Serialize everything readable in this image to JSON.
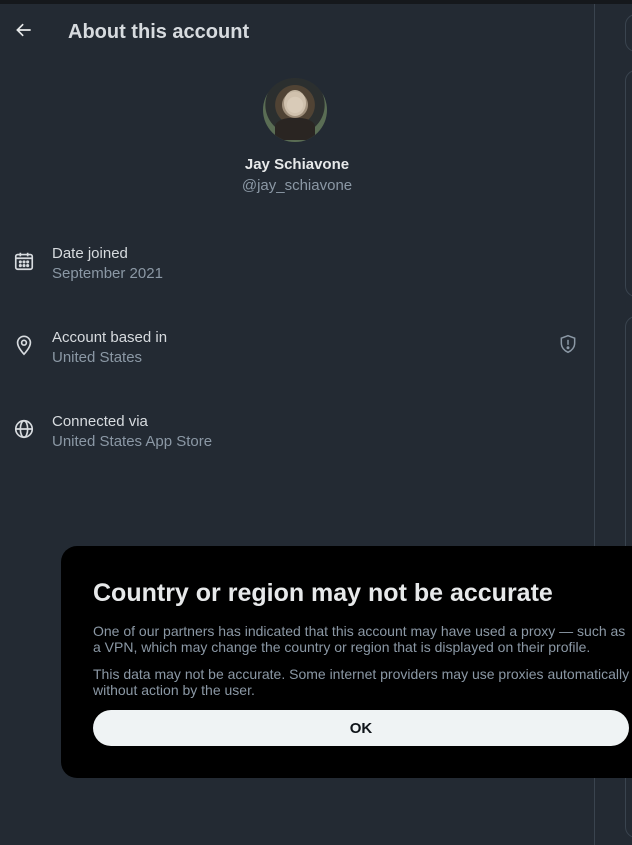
{
  "header": {
    "title": "About this account"
  },
  "profile": {
    "name": "Jay Schiavone",
    "handle": "@jay_schiavone"
  },
  "details": [
    {
      "label": "Date joined",
      "value": "September 2021",
      "icon": "calendar-icon"
    },
    {
      "label": "Account based in",
      "value": "United States",
      "icon": "location-pin-icon",
      "extra_icon": "shield-alert-icon"
    },
    {
      "label": "Connected via",
      "value": "United States App Store",
      "icon": "globe-icon"
    }
  ],
  "dialog": {
    "title": "Country or region may not be accurate",
    "paragraph1": "One of our partners has indicated that this account may have used a proxy — such as a VPN, which may change the country or region that is displayed on their profile.",
    "paragraph2": "This data may not be accurate. Some internet providers may use proxies automatically without action by the user.",
    "ok_label": "OK"
  },
  "colors": {
    "background": "#232a33",
    "dialog_background": "#000000",
    "primary_text": "#e7e9ea",
    "secondary_text": "#8b98a5",
    "button_background": "#eff3f4"
  }
}
